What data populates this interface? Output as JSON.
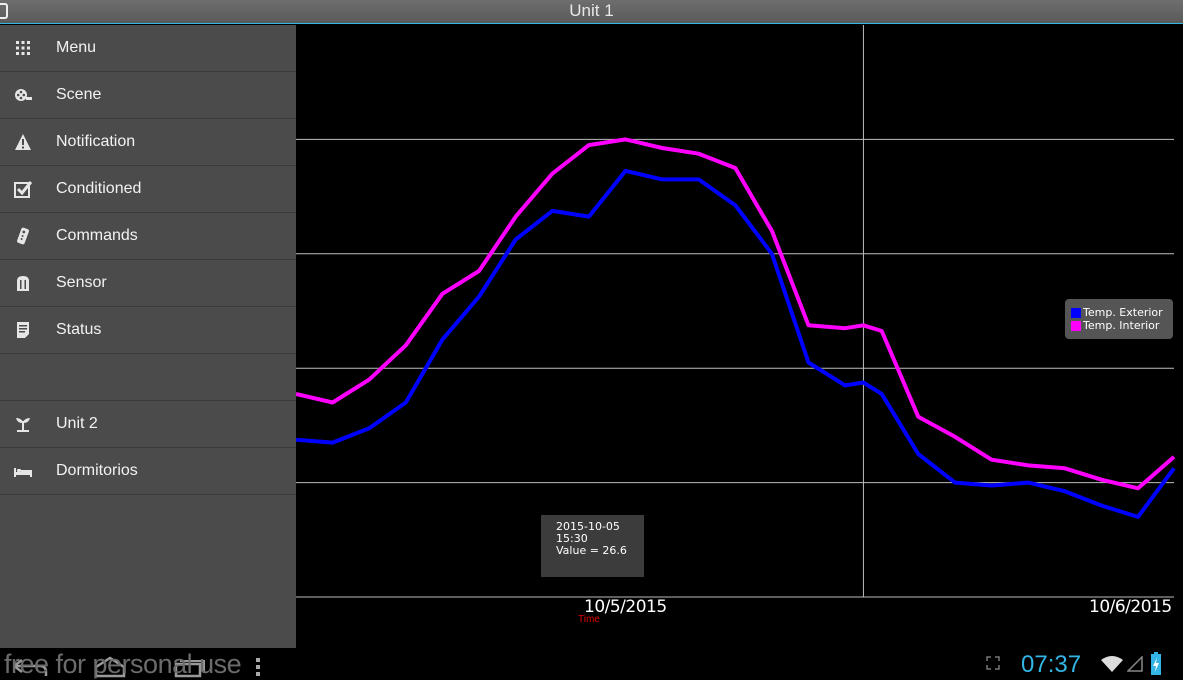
{
  "title_bar": {
    "title": "Unit 1"
  },
  "drawer": {
    "items": [
      {
        "label": "Menu",
        "icon": "grid-icon"
      },
      {
        "label": "Scene",
        "icon": "film-reel-icon"
      },
      {
        "label": "Notification",
        "icon": "warning-icon"
      },
      {
        "label": "Conditioned",
        "icon": "checkbox-icon"
      },
      {
        "label": "Commands",
        "icon": "remote-icon"
      },
      {
        "label": "Sensor",
        "icon": "sensor-icon"
      },
      {
        "label": "Status",
        "icon": "status-icon"
      },
      {
        "label": "Unit 2",
        "icon": "plant-icon"
      },
      {
        "label": "Dormitorios",
        "icon": "bed-icon"
      }
    ]
  },
  "chart_data": {
    "type": "line",
    "title": "",
    "xlabel": "Time",
    "ylabel": "",
    "x_tick_labels": [
      "10/5/2015",
      "10/6/2015"
    ],
    "x_range": [
      "2015-10-05 00:00",
      "2015-10-06 00:00"
    ],
    "grid": true,
    "legend": "right",
    "series": [
      {
        "name": "Temp. Exterior",
        "color": "#0000ff",
        "x": [
          "00:00",
          "01:00",
          "02:00",
          "03:00",
          "04:00",
          "05:00",
          "06:00",
          "07:00",
          "08:00",
          "09:00",
          "10:00",
          "11:00",
          "12:00",
          "13:00",
          "14:00",
          "15:00",
          "15:30",
          "16:00",
          "17:00",
          "18:00",
          "19:00",
          "20:00",
          "21:00",
          "22:00",
          "23:00",
          "23:59"
        ],
        "values": [
          17.5,
          17.4,
          17.9,
          18.8,
          21.0,
          22.5,
          24.5,
          25.5,
          25.3,
          26.9,
          26.6,
          26.6,
          25.7,
          24.0,
          20.2,
          19.4,
          19.5,
          19.1,
          17.0,
          16.0,
          15.9,
          16.0,
          15.7,
          15.2,
          14.8,
          16.5
        ]
      },
      {
        "name": "Temp. Interior",
        "color": "#ff00ff",
        "x": [
          "00:00",
          "01:00",
          "02:00",
          "03:00",
          "04:00",
          "05:00",
          "06:00",
          "07:00",
          "08:00",
          "09:00",
          "10:00",
          "11:00",
          "12:00",
          "13:00",
          "14:00",
          "15:00",
          "15:30",
          "16:00",
          "17:00",
          "18:00",
          "19:00",
          "20:00",
          "21:00",
          "22:00",
          "23:00",
          "23:59"
        ],
        "values": [
          19.1,
          18.8,
          19.6,
          20.8,
          22.6,
          23.4,
          25.3,
          26.8,
          27.8,
          28.0,
          27.7,
          27.5,
          27.0,
          24.8,
          21.5,
          21.4,
          21.5,
          21.3,
          18.3,
          17.6,
          16.8,
          16.6,
          16.5,
          16.1,
          15.8,
          16.9
        ]
      }
    ],
    "ylim": [
      12,
      32
    ],
    "tooltip": {
      "date": "2015-10-05",
      "time": "15:30",
      "value_text": "Value = 26.6"
    }
  },
  "system_bar": {
    "watermark": "free for personal use",
    "clock": "07:37"
  }
}
